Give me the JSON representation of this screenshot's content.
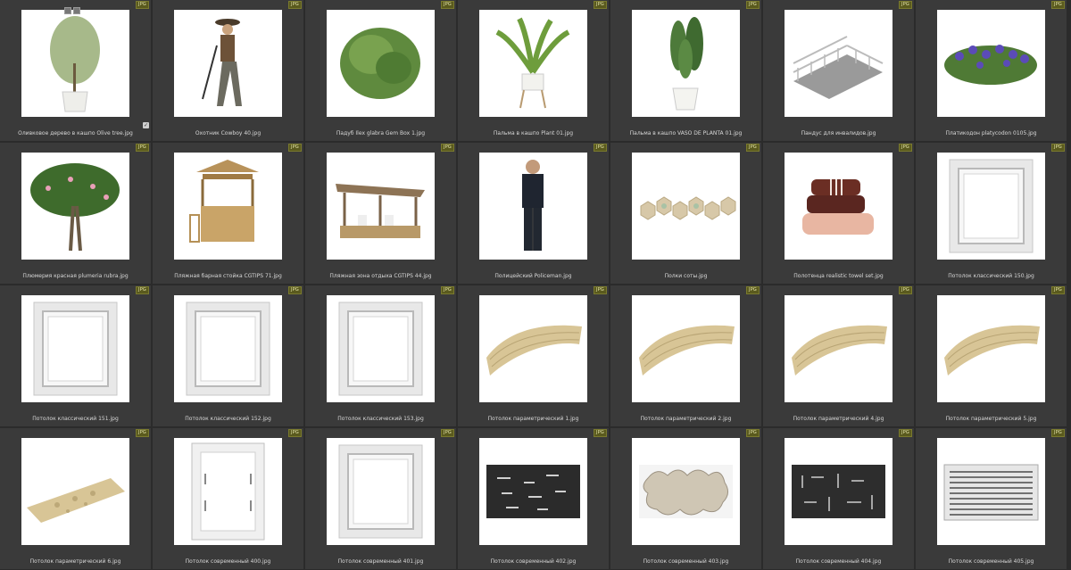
{
  "badge": "JPG",
  "toolbar": {
    "check_mark": "✓"
  },
  "items": [
    {
      "name": "Оливковое дерево в кашпо Olive tree.jpg",
      "icon": "olive-tree"
    },
    {
      "name": "Охотник Cowboy 40.jpg",
      "icon": "cowboy"
    },
    {
      "name": "Падуб Ilex glabra Gem Box 1.jpg",
      "icon": "bush"
    },
    {
      "name": "Пальма в кашпо Plant 01.jpg",
      "icon": "palm-pot"
    },
    {
      "name": "Пальма в кашпо VASO DE PLANTA 01.jpg",
      "icon": "banana-pot"
    },
    {
      "name": "Пандус для инвалидов.jpg",
      "icon": "ramp"
    },
    {
      "name": "Платикодон platycodon 0105.jpg",
      "icon": "flowers"
    },
    {
      "name": "Плюмерия красная plumeria rubra.jpg",
      "icon": "plumeria-tree"
    },
    {
      "name": "Пляжная барная стойка CGTIPS 71.jpg",
      "icon": "bar-stand"
    },
    {
      "name": "Пляжная зона отдыха CGTIPS 44.jpg",
      "icon": "beach-lounge"
    },
    {
      "name": "Полицейский Policeman.jpg",
      "icon": "policeman"
    },
    {
      "name": "Полки соты.jpg",
      "icon": "honeycomb-shelves"
    },
    {
      "name": "Полотенца realistic towel set.jpg",
      "icon": "towels"
    },
    {
      "name": "Потолок классический 150.jpg",
      "icon": "ceiling-classic"
    },
    {
      "name": "Потолок классический 151.jpg",
      "icon": "ceiling-classic"
    },
    {
      "name": "Потолок классический 152.jpg",
      "icon": "ceiling-classic"
    },
    {
      "name": "Потолок классический 153.jpg",
      "icon": "ceiling-classic"
    },
    {
      "name": "Потолок параметрический 1.jpg",
      "icon": "ceiling-parametric"
    },
    {
      "name": "Потолок параметрический 2.jpg",
      "icon": "ceiling-parametric"
    },
    {
      "name": "Потолок параметрический 4.jpg",
      "icon": "ceiling-parametric"
    },
    {
      "name": "Потолок параметрический 5.jpg",
      "icon": "ceiling-parametric"
    },
    {
      "name": "Потолок параметрический 6.jpg",
      "icon": "ceiling-parametric-flat"
    },
    {
      "name": "Потолок современный 400.jpg",
      "icon": "ceiling-modern-door"
    },
    {
      "name": "Потолок современный 401.jpg",
      "icon": "ceiling-classic"
    },
    {
      "name": "Потолок современный 402.jpg",
      "icon": "ceiling-dark-panels"
    },
    {
      "name": "Потолок современный 403.jpg",
      "icon": "ceiling-cloud"
    },
    {
      "name": "Потолок современный 404.jpg",
      "icon": "ceiling-dark-pattern"
    },
    {
      "name": "Потолок современный 405.jpg",
      "icon": "ceiling-slats"
    }
  ]
}
